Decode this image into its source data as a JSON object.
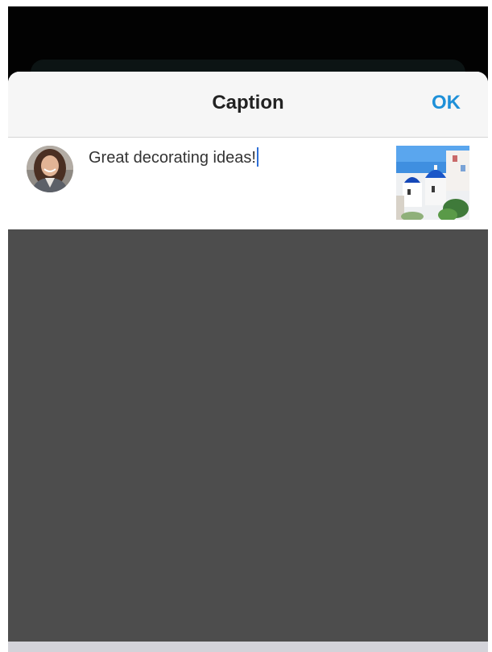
{
  "sheet": {
    "title": "Caption",
    "ok_label": "OK"
  },
  "compose": {
    "caption_text": "Great decorating ideas!",
    "avatar_icon": "user-avatar-photo",
    "thumbnail_icon": "attached-photo-thumbnail"
  },
  "colors": {
    "accent": "#1e90d8",
    "cursor": "#2f6fd6",
    "overlay": "#4d4d4d"
  }
}
